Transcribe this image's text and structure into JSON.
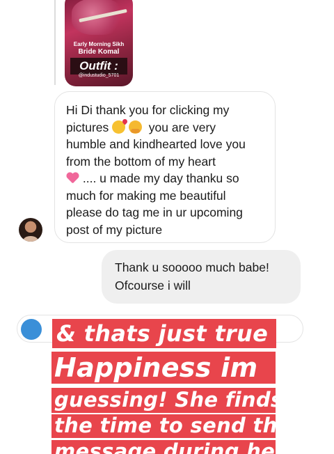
{
  "shared_story": {
    "line1": "Early Morning Sikh",
    "line2": "Bride Komal",
    "line3": "Outfit :",
    "credit": "@industudio_5701"
  },
  "incoming_message": {
    "line1": "Hi Di thank you for clicking my",
    "line2_a": "pictures",
    "line2_b": "you are very",
    "line3": "humble and kindhearted love you",
    "line4": "from the bottom of my heart",
    "line5": ".... u made my day thanku so",
    "line6": "much for making me beautiful",
    "line7": "please do tag me in ur upcoming",
    "line8": "post of my picture",
    "emojis": [
      "face-blowing-kiss-icon",
      "hugging-face-icon",
      "growing-heart-icon"
    ]
  },
  "outgoing_message": {
    "line1": "Thank u sooooo much babe!",
    "line2": "Ofcourse i will"
  },
  "overlay_caption": {
    "lines": [
      "& thats just true",
      "Happiness im",
      "guessing! She finds",
      "the time to send this",
      "message during her"
    ],
    "background": "#e8454c",
    "text_color": "#ffffff"
  }
}
